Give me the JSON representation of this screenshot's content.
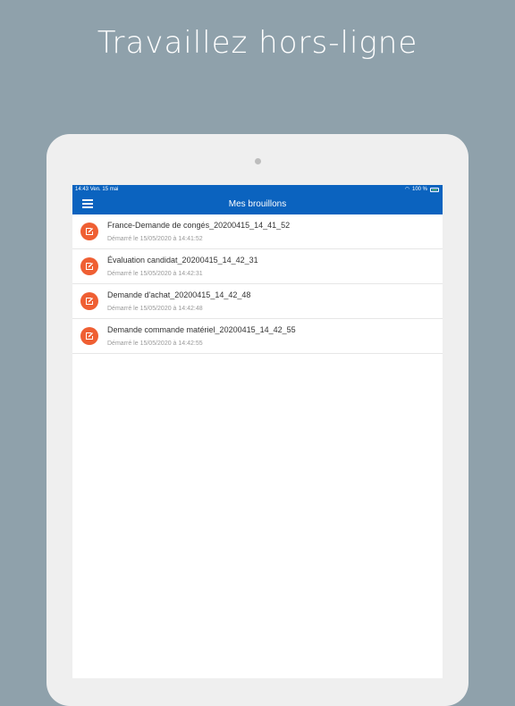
{
  "headline": "Travaillez hors-ligne",
  "status_bar": {
    "time": "14:43",
    "date": "Ven. 15 mai",
    "battery": "100 %"
  },
  "nav": {
    "title": "Mes brouillons",
    "menu_icon": "hamburger-menu-icon"
  },
  "drafts": [
    {
      "title": "France-Demande de congés_20200415_14_41_52",
      "subtitle": "Démarré le 15/05/2020 à 14:41:52"
    },
    {
      "title": "Évaluation candidat_20200415_14_42_31",
      "subtitle": "Démarré le 15/05/2020 à 14:42:31"
    },
    {
      "title": "Demande d'achat_20200415_14_42_48",
      "subtitle": "Démarré le 15/05/2020 à 14:42:48"
    },
    {
      "title": "Demande commande matériel_20200415_14_42_55",
      "subtitle": "Démarré le 15/05/2020 à 14:42:55"
    }
  ],
  "colors": {
    "background": "#8fa1ab",
    "accent": "#0b63bf",
    "draft_icon": "#ef5f33"
  }
}
